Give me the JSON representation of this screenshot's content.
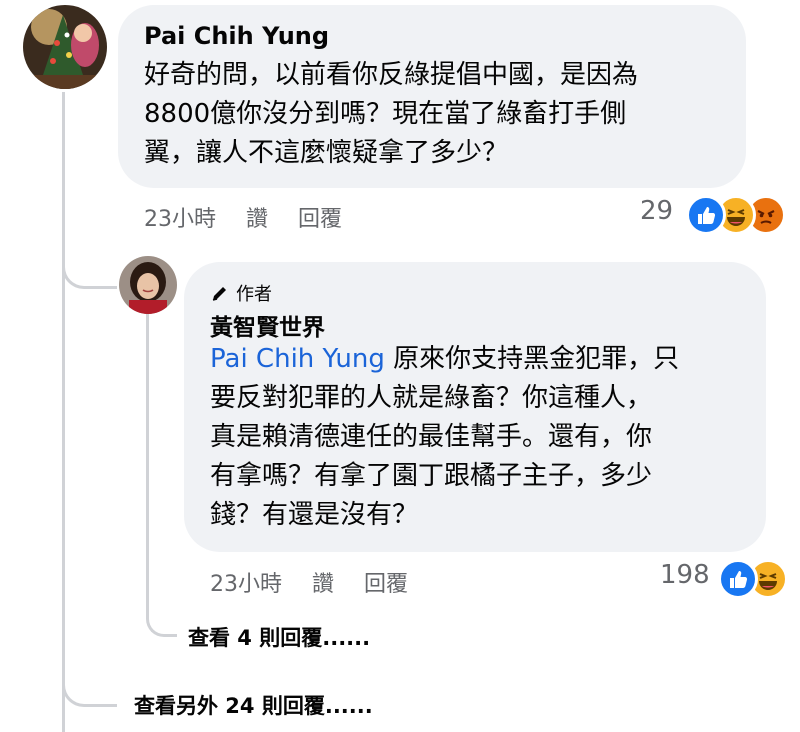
{
  "comment": {
    "author": "Pai Chih Yung",
    "lines": [
      "好奇的問，以前看你反綠提倡中國，是因為",
      "8800億你沒分到嗎？現在當了綠畜打手側",
      "翼，讓人不這麼懷疑拿了多少？"
    ],
    "time": "23小時",
    "like_label": "讚",
    "reply_label": "回覆",
    "reaction_count": "29",
    "reactions": [
      "like-icon",
      "haha-icon",
      "angry-icon"
    ]
  },
  "reply": {
    "badge": "作者",
    "badge_icon": "pen-icon",
    "author": "黃智賢世界",
    "mention": "Pai Chih Yung",
    "first_line_rest": " 原來你支持黑金犯罪，只",
    "lines": [
      "要反對犯罪的人就是綠畜？你這種人，",
      "真是賴清德連任的最佳幫手。還有，你",
      "有拿嗎？有拿了園丁跟橘子主子，多少",
      "錢？有還是沒有？"
    ],
    "time": "23小時",
    "like_label": "讚",
    "reply_label": "回覆",
    "reaction_count": "198",
    "reactions": [
      "like-icon",
      "haha-icon"
    ]
  },
  "view_replies": "查看 4 則回覆......",
  "view_more_replies": "查看另外 24 則回覆......",
  "colors": {
    "like": "#1877f2",
    "haha": "#f7b125",
    "angry": "#e9710f",
    "mention": "#1b64d8"
  }
}
